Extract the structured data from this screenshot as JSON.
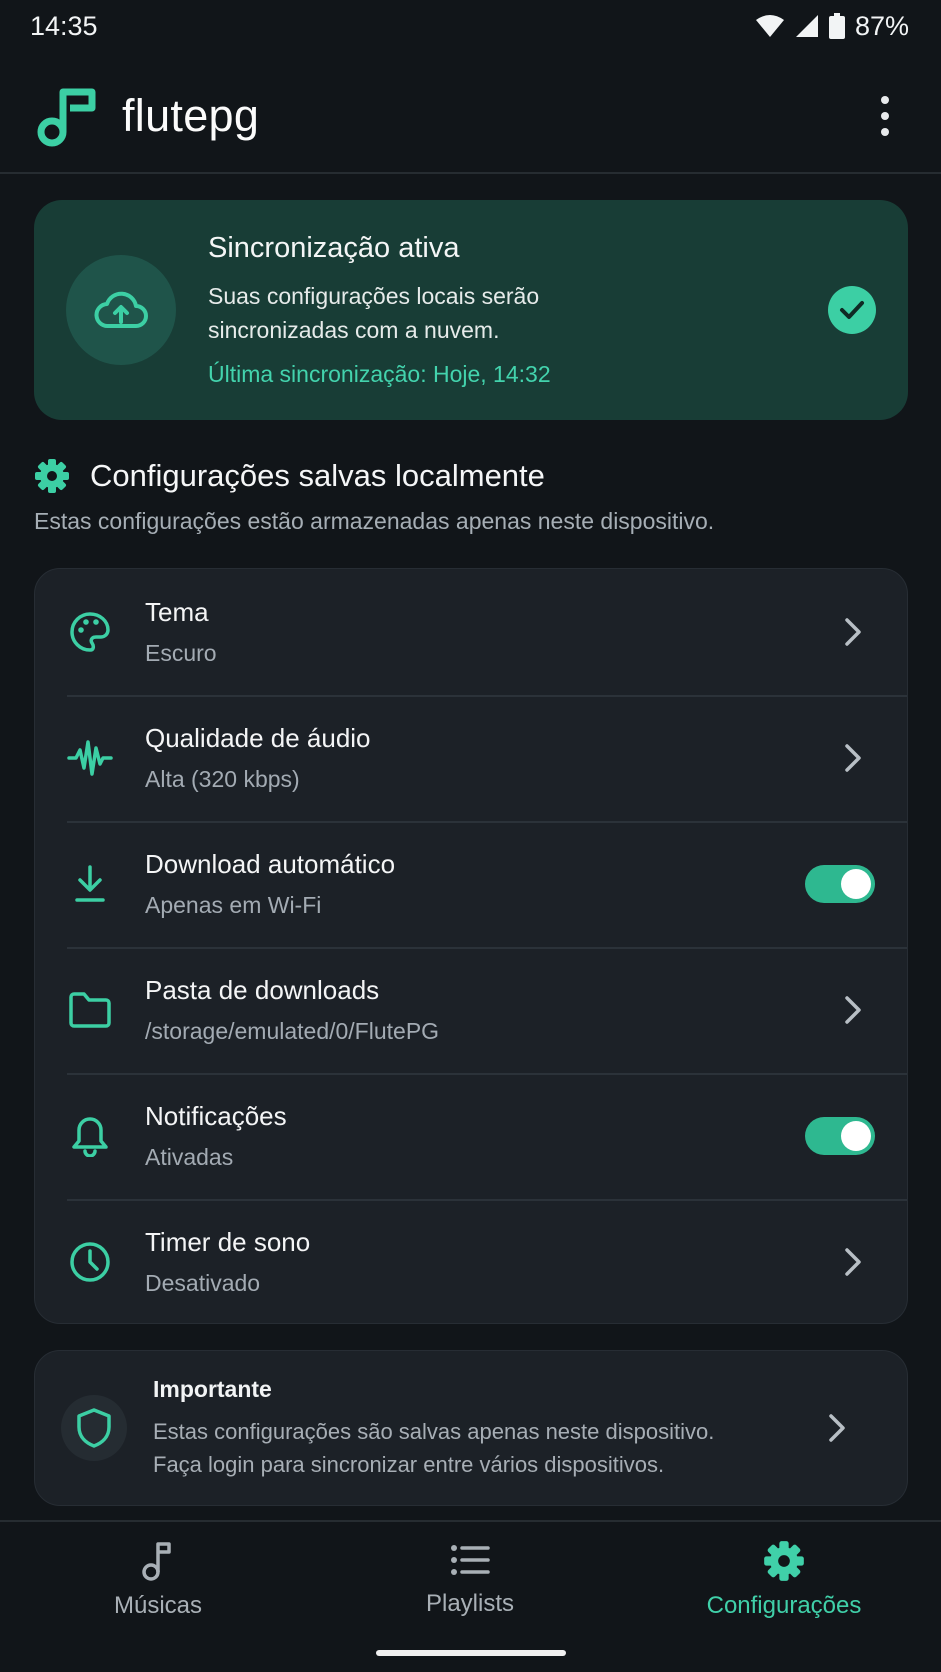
{
  "status": {
    "time": "14:35",
    "battery": "87%"
  },
  "app": {
    "title": "flutepg",
    "logo_icon": "music-note-icon",
    "menu_icon": "more-vert-icon"
  },
  "sync": {
    "title": "Sincronização ativa",
    "description": "Suas configurações locais serão sincronizadas com a nuvem.",
    "last_sync": "Última sincronização: Hoje, 14:32",
    "icon": "cloud-upload-icon",
    "status_icon": "check-icon"
  },
  "section": {
    "title": "Configurações salvas localmente",
    "subtitle": "Estas configurações estão armazenadas apenas neste dispositivo.",
    "icon": "gear-icon"
  },
  "settings": [
    {
      "title": "Tema",
      "subtitle": "Escuro",
      "icon": "palette-icon",
      "control": "chevron"
    },
    {
      "title": "Qualidade de áudio",
      "subtitle": "Alta (320 kbps)",
      "icon": "waveform-icon",
      "control": "chevron"
    },
    {
      "title": "Download automático",
      "subtitle": "Apenas em Wi-Fi",
      "icon": "download-icon",
      "control": "toggle",
      "enabled": true
    },
    {
      "title": "Pasta de downloads",
      "subtitle": "/storage/emulated/0/FlutePG",
      "icon": "folder-icon",
      "control": "chevron"
    },
    {
      "title": "Notificações",
      "subtitle": "Ativadas",
      "icon": "bell-icon",
      "control": "toggle",
      "enabled": true
    },
    {
      "title": "Timer de sono",
      "subtitle": "Desativado",
      "icon": "clock-icon",
      "control": "chevron"
    }
  ],
  "info": {
    "title": "Importante",
    "line1": "Estas configurações são salvas apenas neste dispositivo.",
    "line2": "Faça login para sincronizar entre vários dispositivos.",
    "icon": "shield-icon"
  },
  "nav": [
    {
      "label": "Músicas",
      "icon": "music-note-icon",
      "active": false
    },
    {
      "label": "Playlists",
      "icon": "list-icon",
      "active": false
    },
    {
      "label": "Configurações",
      "icon": "gear-icon",
      "active": true
    }
  ],
  "colors": {
    "accent": "#3ccfa4",
    "background": "#111519",
    "card": "#1c2127",
    "sync_card": "#183d36"
  }
}
